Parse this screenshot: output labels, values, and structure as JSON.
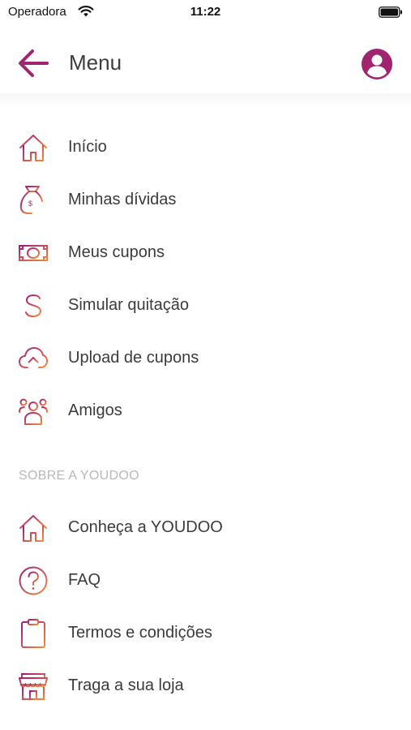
{
  "status_bar": {
    "carrier": "Operadora",
    "time": "11:22"
  },
  "header": {
    "title": "Menu"
  },
  "colors": {
    "accent": "#a0246e",
    "gradient_start": "#a41a78",
    "gradient_end": "#f28a3c"
  },
  "menu_main": [
    {
      "label": "Início",
      "icon": "home-icon"
    },
    {
      "label": "Minhas dívidas",
      "icon": "money-bag-icon"
    },
    {
      "label": "Meus cupons",
      "icon": "banknote-icon"
    },
    {
      "label": "Simular quitação",
      "icon": "dollar-sign-icon"
    },
    {
      "label": "Upload de cupons",
      "icon": "cloud-upload-icon"
    },
    {
      "label": "Amigos",
      "icon": "friends-icon"
    }
  ],
  "section_about": {
    "title": "SOBRE A YOUDOO",
    "items": [
      {
        "label": "Conheça a YOUDOO",
        "icon": "home-icon"
      },
      {
        "label": "FAQ",
        "icon": "question-icon"
      },
      {
        "label": "Termos e condições",
        "icon": "clipboard-icon"
      },
      {
        "label": "Traga a sua loja",
        "icon": "store-icon"
      }
    ]
  }
}
